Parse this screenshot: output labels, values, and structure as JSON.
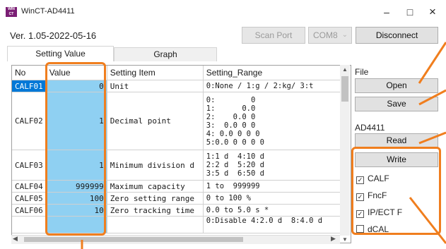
{
  "window": {
    "title": "WinCT-AD4411",
    "icon_text": "WIN CT",
    "minimize": "–",
    "maximize": "□",
    "close": "×"
  },
  "toolbar": {
    "version": "Ver. 1.05-2022-05-16",
    "scan_port": "Scan Port",
    "com_port": "COM8",
    "disconnect": "Disconnect"
  },
  "tabs": [
    {
      "label": "Setting Value",
      "active": true
    },
    {
      "label": "Graph",
      "active": false
    }
  ],
  "grid": {
    "headers": [
      "No",
      "Value",
      "Setting Item",
      "Setting_Range"
    ],
    "rows": [
      {
        "no": "CALF01",
        "value": "0",
        "item": "Unit",
        "range": "0:None / 1:g / 2:kg/ 3:t"
      },
      {
        "no": "CALF02",
        "value": "1",
        "item": "Decimal point",
        "range": "0:        0\n1:      0.0\n2:    0.0 0\n3:  0.0 0 0\n4: 0.0 0 0 0\n5:0.0 0 0 0 0"
      },
      {
        "no": "CALF03",
        "value": "1",
        "item": "Minimum division d",
        "range": "1:1 d  4:10 d\n2:2 d  5:20 d\n3:5 d  6:50 d"
      },
      {
        "no": "CALF04",
        "value": "999999",
        "item": "Maximum capacity",
        "range": "1 to  999999"
      },
      {
        "no": "CALF05",
        "value": "100",
        "item": "Zero setting range",
        "range": "0 to 100 %"
      },
      {
        "no": "CALF06",
        "value": "10",
        "item": "Zero tracking time",
        "range": "0.0 to 5.0 s *"
      },
      {
        "no": "",
        "value": "",
        "item": "",
        "range": "0:Disable 4:2.0 d  8:4.0 d"
      }
    ]
  },
  "panel": {
    "file_label": "File",
    "open": "Open",
    "save": "Save",
    "device_label": "AD4411",
    "read": "Read",
    "write": "Write",
    "checkboxes": [
      {
        "label": "CALF",
        "checked": true
      },
      {
        "label": "FncF",
        "checked": true
      },
      {
        "label": "IP/ECT F",
        "checked": true
      },
      {
        "label": "dCAL",
        "checked": false
      }
    ]
  },
  "colors": {
    "highlight": "#f07e1e",
    "value_cell": "#8fd0f2",
    "selected_row": "#0078d7"
  }
}
